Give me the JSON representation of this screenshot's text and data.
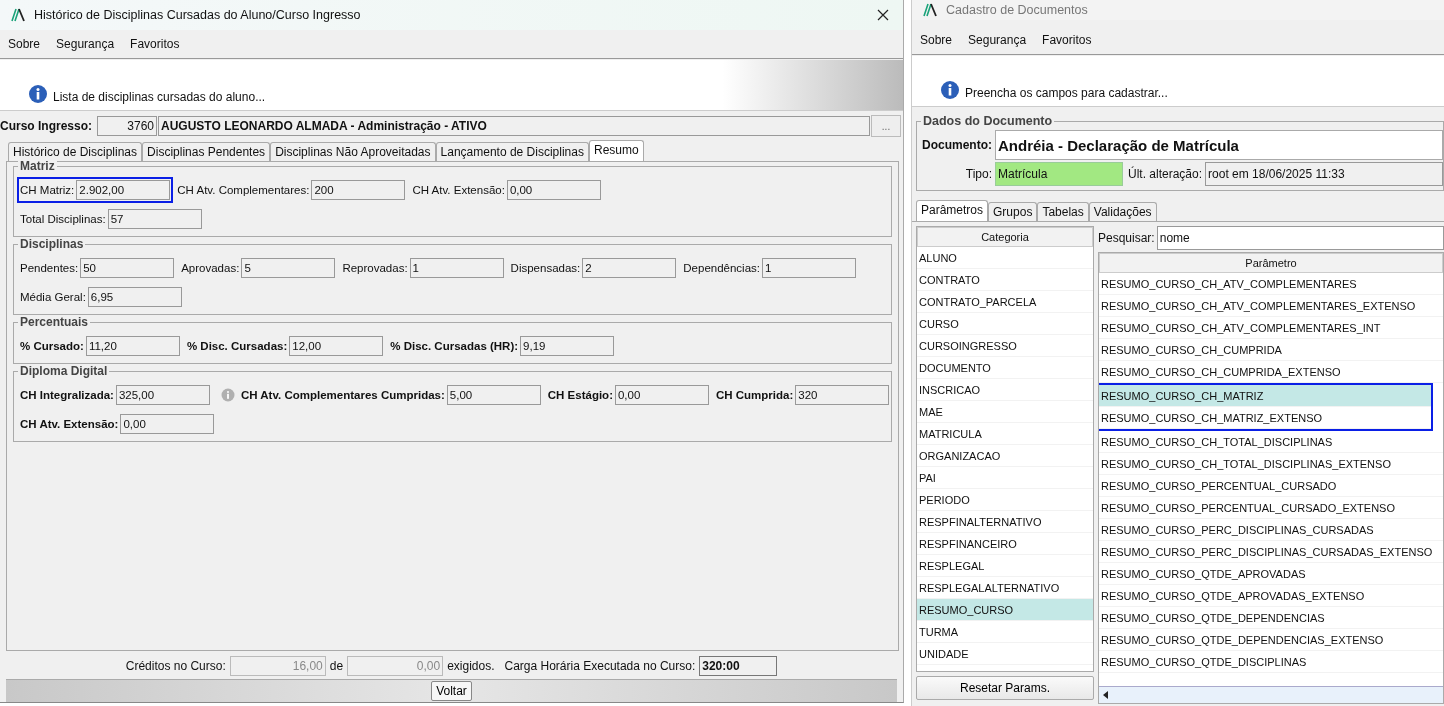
{
  "left_window": {
    "title": "Histórico de Disciplinas Cursadas do Aluno/Curso Ingresso",
    "menu": [
      "Sobre",
      "Segurança",
      "Favoritos"
    ],
    "info": "Lista de disciplinas cursadas do aluno...",
    "curso_ingresso": {
      "label": "Curso Ingresso:",
      "code": "3760",
      "value": "AUGUSTO LEONARDO ALMADA - Administração - ATIVO",
      "button": "..."
    },
    "tabs": [
      {
        "label": "Histórico de Disciplinas",
        "selected": false
      },
      {
        "label": "Disciplinas Pendentes",
        "selected": false
      },
      {
        "label": "Disciplinas Não Aproveitadas",
        "selected": false
      },
      {
        "label": "Lançamento de Disciplinas",
        "selected": false
      },
      {
        "label": "Resumo",
        "selected": true
      }
    ],
    "groups": [
      {
        "title": "Matriz",
        "bold_labels": false,
        "rows": [
          [
            {
              "label": "CH Matriz:",
              "value": "2.902,00",
              "highlighted": true
            },
            {
              "label": "CH Atv. Complementares:",
              "value": "200",
              "highlighted": false
            },
            {
              "label": "CH Atv. Extensão:",
              "value": "0,00",
              "highlighted": false
            }
          ],
          [
            {
              "label": "Total Disciplinas:",
              "value": "57",
              "highlighted": false
            }
          ]
        ]
      },
      {
        "title": "Disciplinas",
        "bold_labels": false,
        "rows": [
          [
            {
              "label": "Pendentes:",
              "value": "50",
              "highlighted": false
            },
            {
              "label": "Aprovadas:",
              "value": "5",
              "highlighted": false
            },
            {
              "label": "Reprovadas:",
              "value": "1",
              "highlighted": false
            },
            {
              "label": "Dispensadas:",
              "value": "2",
              "highlighted": false
            },
            {
              "label": "Dependências:",
              "value": "1",
              "highlighted": false
            }
          ],
          [
            {
              "label": "Média Geral:",
              "value": "6,95",
              "highlighted": false
            }
          ]
        ]
      },
      {
        "title": "Percentuais",
        "bold_labels": true,
        "rows": [
          [
            {
              "label": "% Cursado:",
              "value": "11,20",
              "highlighted": false
            },
            {
              "label": "% Disc. Cursadas:",
              "value": "12,00",
              "highlighted": false
            },
            {
              "label": "% Disc. Cursadas (HR):",
              "value": "9,19",
              "highlighted": false
            }
          ]
        ]
      },
      {
        "title": "Diploma Digital",
        "bold_labels": true,
        "rows": [
          [
            {
              "label": "CH Integralizada:",
              "value": "325,00",
              "highlighted": false
            },
            {
              "label": "CH Atv. Complementares Cumpridas:",
              "value": "5,00",
              "highlighted": false,
              "info_icon": true
            },
            {
              "label": "CH Estágio:",
              "value": "0,00",
              "highlighted": false
            },
            {
              "label": "CH Cumprida:",
              "value": "320",
              "highlighted": false
            }
          ],
          [
            {
              "label": "CH Atv. Extensão:",
              "value": "0,00",
              "highlighted": false
            }
          ]
        ]
      }
    ],
    "footer": {
      "creditos_label": "Créditos no Curso:",
      "creditos": "16,00",
      "de": "de",
      "exigidos_value": "0,00",
      "exigidos": "exigidos.",
      "carga_label": "Carga Horária Executada no Curso:",
      "carga": "320:00"
    },
    "button": "Voltar"
  },
  "right_window": {
    "title": "Cadastro de Documentos",
    "menu": [
      "Sobre",
      "Segurança",
      "Favoritos"
    ],
    "info": "Preencha os campos para cadastrar...",
    "group_title": "Dados do Documento",
    "documento_label": "Documento:",
    "documento": "Andréia - Declaração de Matrícula",
    "tipo_label": "Tipo:",
    "tipo": "Matrícula",
    "alteracao_label": "Últ. alteração:",
    "alteracao": "root em 18/06/2025 11:33",
    "tabs": [
      {
        "label": "Parâmetros",
        "selected": true
      },
      {
        "label": "Grupos",
        "selected": false
      },
      {
        "label": "Tabelas",
        "selected": false
      },
      {
        "label": "Validações",
        "selected": false
      }
    ],
    "categoria_header": "Categoria",
    "categories": [
      {
        "label": "ALUNO",
        "selected": false
      },
      {
        "label": "CONTRATO",
        "selected": false
      },
      {
        "label": "CONTRATO_PARCELA",
        "selected": false
      },
      {
        "label": "CURSO",
        "selected": false
      },
      {
        "label": "CURSOINGRESSO",
        "selected": false
      },
      {
        "label": "DOCUMENTO",
        "selected": false
      },
      {
        "label": "INSCRICAO",
        "selected": false
      },
      {
        "label": "MAE",
        "selected": false
      },
      {
        "label": "MATRICULA",
        "selected": false
      },
      {
        "label": "ORGANIZACAO",
        "selected": false
      },
      {
        "label": "PAI",
        "selected": false
      },
      {
        "label": "PERIODO",
        "selected": false
      },
      {
        "label": "RESPFINALTERNATIVO",
        "selected": false
      },
      {
        "label": "RESPFINANCEIRO",
        "selected": false
      },
      {
        "label": "RESPLEGAL",
        "selected": false
      },
      {
        "label": "RESPLEGALALTERNATIVO",
        "selected": false
      },
      {
        "label": "RESUMO_CURSO",
        "selected": true
      },
      {
        "label": "TURMA",
        "selected": false
      },
      {
        "label": "UNIDADE",
        "selected": false
      }
    ],
    "reset_button": "Resetar Params.",
    "search_label": "Pesquisar:",
    "search_value": "nome",
    "param_header": "Parâmetro",
    "params": [
      {
        "label": "RESUMO_CURSO_CH_ATV_COMPLEMENTARES",
        "selected": false,
        "highlighted": false
      },
      {
        "label": "RESUMO_CURSO_CH_ATV_COMPLEMENTARES_EXTENSO",
        "selected": false,
        "highlighted": false
      },
      {
        "label": "RESUMO_CURSO_CH_ATV_COMPLEMENTARES_INT",
        "selected": false,
        "highlighted": false
      },
      {
        "label": "RESUMO_CURSO_CH_CUMPRIDA",
        "selected": false,
        "highlighted": false
      },
      {
        "label": "RESUMO_CURSO_CH_CUMPRIDA_EXTENSO",
        "selected": false,
        "highlighted": false
      },
      {
        "label": "RESUMO_CURSO_CH_MATRIZ",
        "selected": true,
        "highlighted": true
      },
      {
        "label": "RESUMO_CURSO_CH_MATRIZ_EXTENSO",
        "selected": false,
        "highlighted": true
      },
      {
        "label": "RESUMO_CURSO_CH_TOTAL_DISCIPLINAS",
        "selected": false,
        "highlighted": false
      },
      {
        "label": "RESUMO_CURSO_CH_TOTAL_DISCIPLINAS_EXTENSO",
        "selected": false,
        "highlighted": false
      },
      {
        "label": "RESUMO_CURSO_PERCENTUAL_CURSADO",
        "selected": false,
        "highlighted": false
      },
      {
        "label": "RESUMO_CURSO_PERCENTUAL_CURSADO_EXTENSO",
        "selected": false,
        "highlighted": false
      },
      {
        "label": "RESUMO_CURSO_PERC_DISCIPLINAS_CURSADAS",
        "selected": false,
        "highlighted": false
      },
      {
        "label": "RESUMO_CURSO_PERC_DISCIPLINAS_CURSADAS_EXTENSO",
        "selected": false,
        "highlighted": false
      },
      {
        "label": "RESUMO_CURSO_QTDE_APROVADAS",
        "selected": false,
        "highlighted": false
      },
      {
        "label": "RESUMO_CURSO_QTDE_APROVADAS_EXTENSO",
        "selected": false,
        "highlighted": false
      },
      {
        "label": "RESUMO_CURSO_QTDE_DEPENDENCIAS",
        "selected": false,
        "highlighted": false
      },
      {
        "label": "RESUMO_CURSO_QTDE_DEPENDENCIAS_EXTENSO",
        "selected": false,
        "highlighted": false
      },
      {
        "label": "RESUMO_CURSO_QTDE_DISCIPLINAS",
        "selected": false,
        "highlighted": false
      }
    ]
  }
}
